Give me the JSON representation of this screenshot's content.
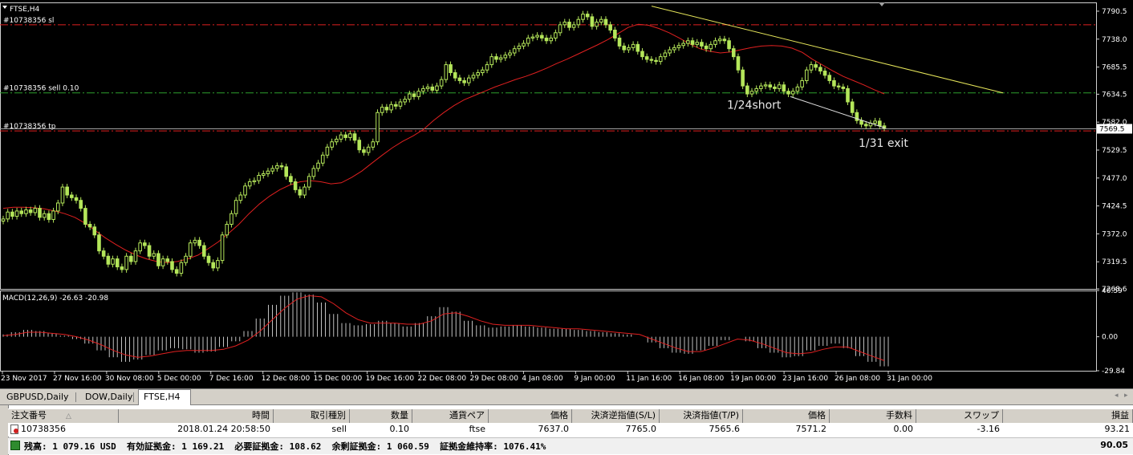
{
  "chart_data": [
    {
      "type": "line",
      "title": "FTSE,H4",
      "symbol": "FTSE",
      "timeframe": "H4",
      "ylim": [
        7268.6,
        7807.0
      ],
      "y_ticks": [
        7790.5,
        7738.0,
        7685.5,
        7634.5,
        7582.0,
        7529.5,
        7477.0,
        7424.5,
        7372.0,
        7319.5,
        7268.6
      ],
      "x_ticks": [
        "23 Nov 2017",
        "27 Nov 16:00",
        "30 Nov 08:00",
        "5 Dec 00:00",
        "7 Dec 16:00",
        "12 Dec 08:00",
        "15 Dec 00:00",
        "19 Dec 16:00",
        "22 Dec 08:00",
        "29 Dec 08:00",
        "4 Jan 08:00",
        "9 Jan 00:00",
        "11 Jan 16:00",
        "16 Jan 08:00",
        "19 Jan 00:00",
        "23 Jan 16:00",
        "26 Jan 08:00",
        "31 Jan 00:00"
      ],
      "current_price": 7569.5,
      "series": [
        {
          "kind": "candles",
          "color": "#b4e65a",
          "close": [
            7400,
            7413,
            7405,
            7415,
            7410,
            7417,
            7412,
            7420,
            7403,
            7410,
            7399,
            7415,
            7430,
            7460,
            7445,
            7440,
            7435,
            7420,
            7390,
            7385,
            7370,
            7340,
            7330,
            7315,
            7325,
            7310,
            7305,
            7330,
            7320,
            7340,
            7355,
            7350,
            7330,
            7335,
            7312,
            7325,
            7320,
            7305,
            7298,
            7318,
            7330,
            7355,
            7360,
            7350,
            7330,
            7318,
            7308,
            7322,
            7370,
            7390,
            7410,
            7435,
            7445,
            7462,
            7470,
            7472,
            7482,
            7485,
            7490,
            7495,
            7500,
            7498,
            7480,
            7470,
            7455,
            7445,
            7460,
            7480,
            7495,
            7505,
            7520,
            7535,
            7545,
            7550,
            7558,
            7553,
            7560,
            7548,
            7530,
            7525,
            7535,
            7545,
            7600,
            7610,
            7605,
            7615,
            7612,
            7620,
            7625,
            7635,
            7630,
            7640,
            7645,
            7648,
            7642,
            7650,
            7662,
            7690,
            7675,
            7665,
            7660,
            7656,
            7665,
            7670,
            7675,
            7680,
            7690,
            7705,
            7700,
            7703,
            7708,
            7712,
            7720,
            7725,
            7730,
            7740,
            7742,
            7745,
            7740,
            7735,
            7740,
            7750,
            7765,
            7770,
            7760,
            7765,
            7775,
            7785,
            7780,
            7762,
            7770,
            7775,
            7765,
            7755,
            7740,
            7725,
            7718,
            7722,
            7728,
            7715,
            7705,
            7700,
            7698,
            7696,
            7705,
            7712,
            7718,
            7722,
            7726,
            7730,
            7735,
            7728,
            7732,
            7725,
            7720,
            7728,
            7735,
            7738,
            7735,
            7720,
            7705,
            7680,
            7650,
            7635,
            7640,
            7645,
            7650,
            7652,
            7648,
            7645,
            7652,
            7640,
            7635,
            7640,
            7648,
            7660,
            7680,
            7690,
            7685,
            7678,
            7670,
            7660,
            7650,
            7648,
            7645,
            7620,
            7600,
            7585,
            7578,
            7575,
            7580,
            7584,
            7575,
            7571
          ]
        },
        {
          "kind": "moving_average",
          "color": "#e02020",
          "values": [
            7420,
            7422,
            7422,
            7421,
            7419,
            7415,
            7410,
            7403,
            7392,
            7378,
            7364,
            7352,
            7341,
            7332,
            7325,
            7320,
            7318,
            7320,
            7325,
            7332,
            7344,
            7357,
            7373,
            7390,
            7410,
            7428,
            7443,
            7455,
            7464,
            7470,
            7472,
            7470,
            7466,
            7468,
            7478,
            7490,
            7505,
            7520,
            7534,
            7546,
            7556,
            7568,
            7585,
            7600,
            7613,
            7624,
            7632,
            7640,
            7648,
            7655,
            7662,
            7668,
            7675,
            7683,
            7692,
            7700,
            7709,
            7718,
            7727,
            7737,
            7748,
            7760,
            7766,
            7764,
            7758,
            7750,
            7740,
            7729,
            7720,
            7715,
            7712,
            7714,
            7718,
            7722,
            7725,
            7726,
            7725,
            7721,
            7713,
            7700,
            7689,
            7678,
            7668,
            7660,
            7652,
            7643,
            7635
          ]
        },
        {
          "kind": "trendline",
          "color": "#e6e65a",
          "points": [
            [
              0,
              7800
            ],
            [
              1,
              7637
            ]
          ]
        },
        {
          "kind": "trendline",
          "color": "#e0e0e0",
          "points": [
            [
              0,
              7630
            ],
            [
              1,
              7571
            ]
          ]
        }
      ],
      "levels": [
        {
          "label": "#10738356 sl",
          "value": 7765.0,
          "color": "#e02020",
          "style": "dash-dot"
        },
        {
          "label": "#10738356 sell 0.10",
          "value": 7637.0,
          "color": "#2ea02e",
          "style": "dash-dot"
        },
        {
          "label": "#10738356 tp",
          "value": 7565.6,
          "color": "#e02020",
          "style": "dash-dot"
        },
        {
          "label": "",
          "value": 7569.5,
          "color": "#a0a0a0",
          "style": "solid"
        }
      ],
      "annotations": [
        {
          "text": "1/24short",
          "x_label": "23 Jan 16:00",
          "y": 7612
        },
        {
          "text": "1/31 exit",
          "x_label": "31 Jan 00:00",
          "y": 7540
        }
      ]
    },
    {
      "type": "bar",
      "title": "MACD(12,26,9) -26.63 -20.98",
      "ylim": [
        -29.84,
        40.59
      ],
      "y_ticks": [
        40.59,
        0.0,
        -29.84
      ],
      "macd_value": -26.63,
      "signal_value": -20.98,
      "series": [
        {
          "name": "MACD",
          "kind": "histogram",
          "color": "#c0c0c0",
          "values": [
            2,
            4,
            6,
            5,
            3,
            1,
            -2,
            -6,
            -12,
            -18,
            -22,
            -20,
            -16,
            -12,
            -10,
            -11,
            -14,
            -13,
            -9,
            -4,
            5,
            16,
            28,
            36,
            39,
            37,
            30,
            20,
            12,
            10,
            11,
            14,
            12,
            9,
            12,
            18,
            26,
            22,
            14,
            10,
            8,
            9,
            10,
            9,
            8,
            7,
            7,
            6,
            5,
            4,
            3,
            2,
            0,
            -5,
            -10,
            -14,
            -15,
            -12,
            -8,
            -3,
            0,
            -4,
            -10,
            -14,
            -18,
            -17,
            -12,
            -8,
            -6,
            -10,
            -17,
            -22,
            -26
          ]
        },
        {
          "name": "Signal",
          "kind": "line",
          "color": "#e02020",
          "values": [
            1,
            2,
            4,
            4,
            3,
            2,
            0,
            -3,
            -7,
            -12,
            -16,
            -18,
            -17,
            -15,
            -13,
            -12,
            -12,
            -12,
            -11,
            -8,
            -3,
            5,
            15,
            25,
            33,
            36,
            35,
            29,
            21,
            15,
            12,
            12,
            12,
            11,
            11,
            14,
            20,
            21,
            18,
            14,
            11,
            10,
            10,
            10,
            9,
            8,
            7,
            7,
            6,
            5,
            4,
            3,
            2,
            -2,
            -6,
            -10,
            -13,
            -13,
            -10,
            -6,
            -2,
            -3,
            -6,
            -10,
            -14,
            -15,
            -14,
            -11,
            -9,
            -9,
            -13,
            -17,
            -21
          ]
        }
      ]
    }
  ],
  "tabs": [
    {
      "label": "GBPUSD,Daily",
      "active": false
    },
    {
      "label": "DOW,Daily",
      "active": false
    },
    {
      "label": "FTSE,H4",
      "active": true
    }
  ],
  "terminal": {
    "columns": [
      "注文番号",
      "時間",
      "取引種別",
      "数量",
      "通貨ペア",
      "価格",
      "決済逆指値(S/L)",
      "決済指値(T/P)",
      "価格",
      "手数料",
      "スワップ",
      "損益"
    ],
    "rows": [
      [
        "10738356",
        "2018.01.24 20:58:50",
        "sell",
        "0.10",
        "ftse",
        "7637.0",
        "7765.0",
        "7565.6",
        "7571.2",
        "0.00",
        "-3.16",
        "93.21"
      ]
    ],
    "account_text": "残高: 1 079.16 USD  有効証拠金: 1 169.21  必要証拠金: 108.62  余剰証拠金: 1 060.59  証拠金維持率: 1076.41%",
    "account_total": "90.05"
  }
}
